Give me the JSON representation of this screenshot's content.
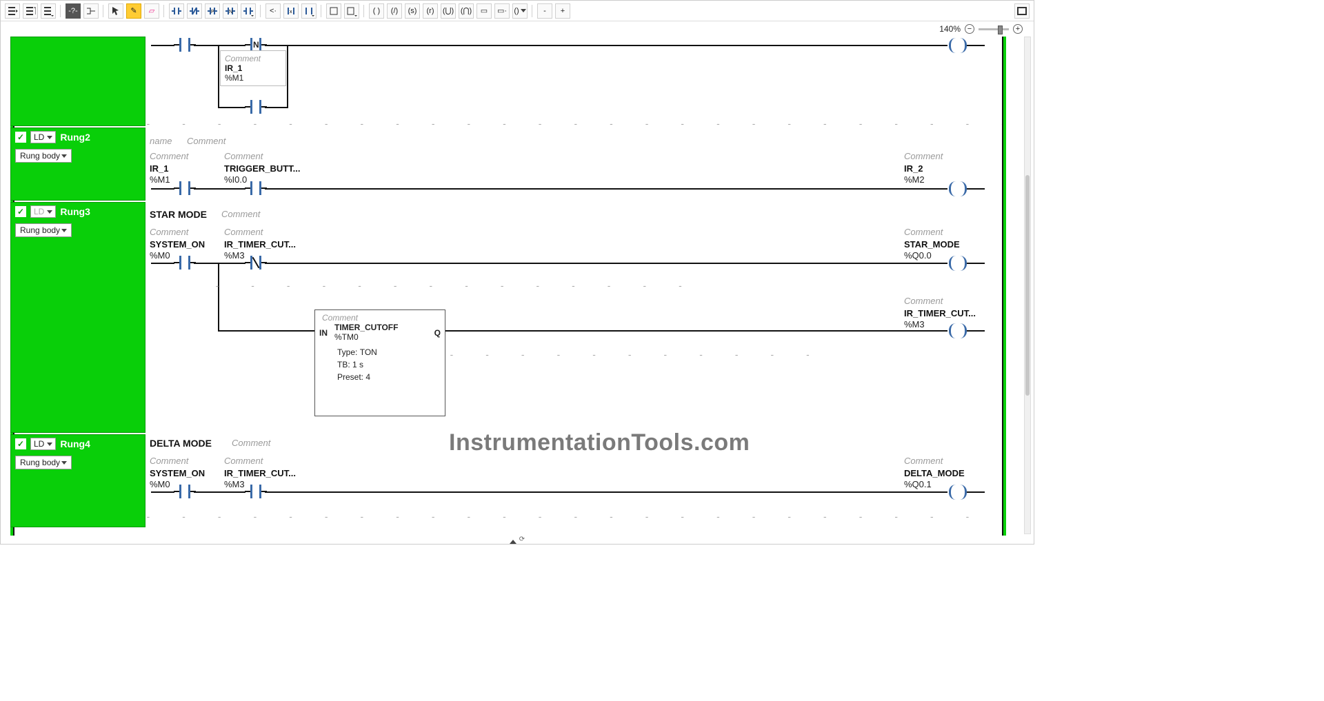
{
  "toolbar": {
    "zoom": "140%"
  },
  "placeholders": {
    "name": "name",
    "comment": "Comment"
  },
  "rungs": {
    "r0": {
      "branch": {
        "comment": "Comment",
        "name": "IR_1",
        "addr": "%M1"
      }
    },
    "r2": {
      "label": "LD",
      "title": "Rung2",
      "body": "Rung body",
      "c1": {
        "comment": "Comment",
        "name": "IR_1",
        "addr": "%M1"
      },
      "c2": {
        "comment": "Comment",
        "name": "TRIGGER_BUTT...",
        "addr": "%I0.0"
      },
      "out": {
        "comment": "Comment",
        "name": "IR_2",
        "addr": "%M2"
      }
    },
    "r3": {
      "label": "LD",
      "title": "Rung3",
      "body": "Rung body",
      "section": "STAR MODE",
      "c1": {
        "comment": "Comment",
        "name": "SYSTEM_ON",
        "addr": "%M0"
      },
      "c2": {
        "comment": "Comment",
        "name": "IR_TIMER_CUT...",
        "addr": "%M3"
      },
      "out1": {
        "comment": "Comment",
        "name": "STAR_MODE",
        "addr": "%Q0.0"
      },
      "out2": {
        "comment": "Comment",
        "name": "IR_TIMER_CUT...",
        "addr": "%M3"
      },
      "timer": {
        "comment": "Comment",
        "name": "TIMER_CUTOFF",
        "addr": "%TM0",
        "type": "TON",
        "tb": "1 s",
        "preset": "4",
        "in": "IN",
        "q": "Q"
      }
    },
    "r4": {
      "label": "LD",
      "title": "Rung4",
      "body": "Rung body",
      "section": "DELTA MODE",
      "c1": {
        "comment": "Comment",
        "name": "SYSTEM_ON",
        "addr": "%M0"
      },
      "c2": {
        "comment": "Comment",
        "name": "IR_TIMER_CUT...",
        "addr": "%M3"
      },
      "out": {
        "comment": "Comment",
        "name": "DELTA_MODE",
        "addr": "%Q0.1"
      }
    }
  },
  "timer_labels": {
    "type": "Type:",
    "tb": "TB:",
    "preset": "Preset:"
  },
  "watermark": "InstrumentationTools.com"
}
